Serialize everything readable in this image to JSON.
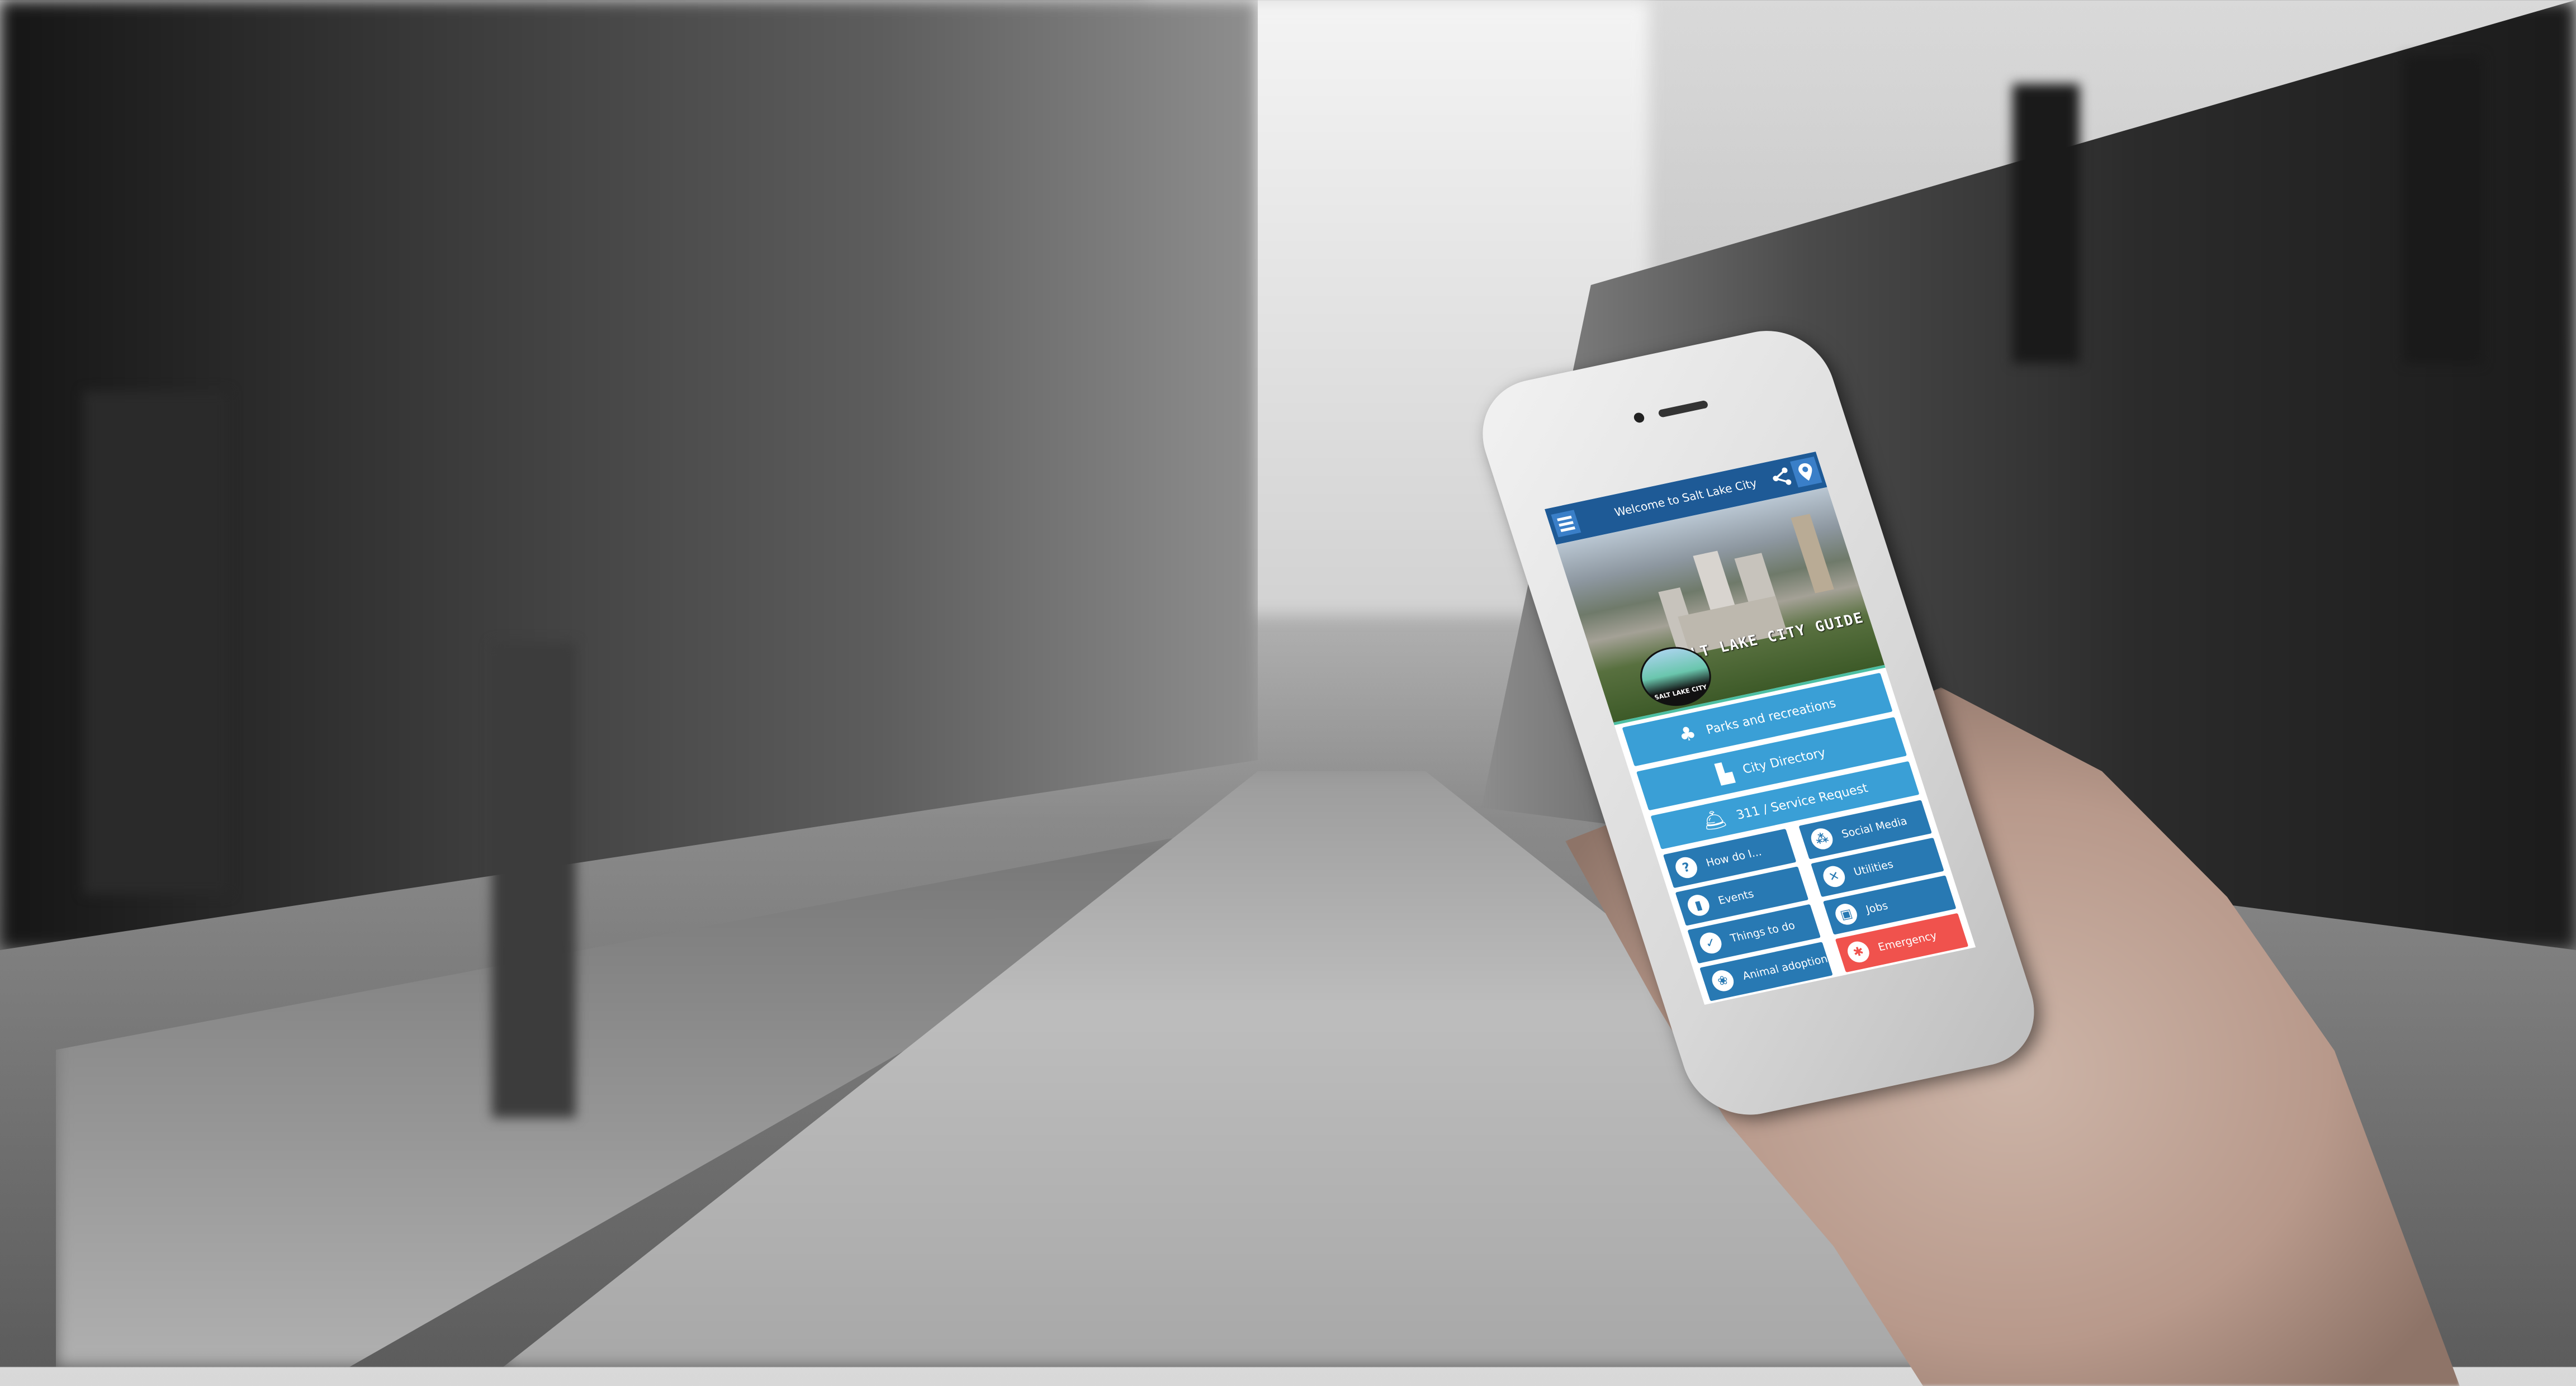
{
  "app": {
    "header": {
      "title": "Welcome to Salt Lake City",
      "menu_icon": "hamburger-icon",
      "share_icon": "share-icon",
      "location_icon": "map-pin-icon"
    },
    "hero": {
      "guide_text": "SALT LAKE CITY GUIDE",
      "logo_text": "SALT LAKE CITY"
    },
    "main_buttons": [
      {
        "label": "Parks and recreations",
        "icon": "trees-icon",
        "glyph": "♣"
      },
      {
        "label": "City Directory",
        "icon": "buildings-icon",
        "glyph": "▙"
      },
      {
        "label": "311 / Service Request",
        "icon": "service-bell-icon",
        "glyph": "🛎"
      }
    ],
    "left_grid": [
      {
        "label": "How do I...",
        "icon": "question-icon",
        "glyph": "?"
      },
      {
        "label": "Events",
        "icon": "ticket-icon",
        "glyph": "▮"
      },
      {
        "label": "Things to do",
        "icon": "checkmark-icon",
        "glyph": "✓"
      },
      {
        "label": "Animal adoption",
        "icon": "paw-icon",
        "glyph": "❀"
      }
    ],
    "right_grid": [
      {
        "label": "Social Media",
        "icon": "network-icon",
        "glyph": "⁂"
      },
      {
        "label": "Utilities",
        "icon": "tools-icon",
        "glyph": "✕"
      },
      {
        "label": "Jobs",
        "icon": "briefcase-icon",
        "glyph": "▣"
      },
      {
        "label": "Emergency",
        "icon": "siren-icon",
        "glyph": "✱"
      }
    ],
    "colors": {
      "header": "#1e5a96",
      "primary": "#3a9fd6",
      "secondary": "#2879b3",
      "emergency": "#f0524d"
    }
  }
}
